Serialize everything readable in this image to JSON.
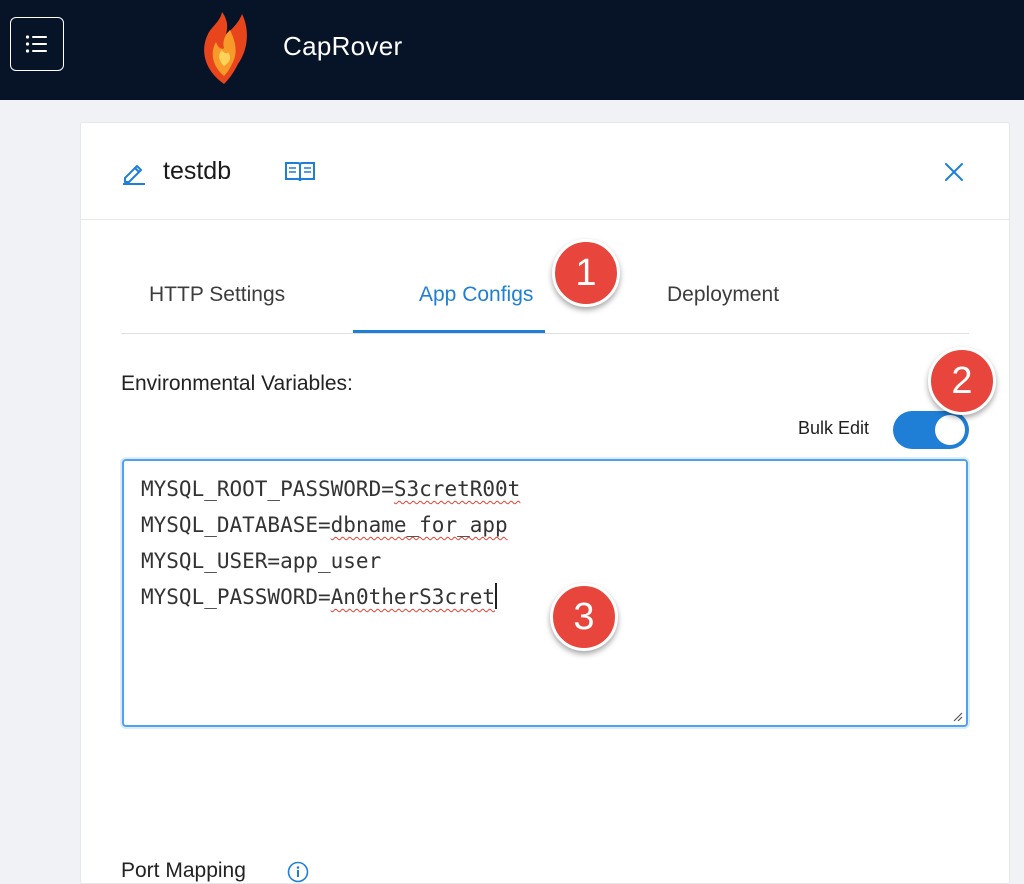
{
  "header": {
    "brand": "CapRover",
    "menu_icon": "list-icon",
    "logo_icon": "flame-logo-icon"
  },
  "app": {
    "name": "testdb",
    "edit_icon": "pencil-icon",
    "docs_icon": "book-icon",
    "close_icon": "close-icon"
  },
  "tabs": [
    {
      "label": "HTTP Settings",
      "active": false
    },
    {
      "label": "App Configs",
      "active": true
    },
    {
      "label": "Deployment",
      "active": false
    }
  ],
  "env": {
    "label": "Environmental Variables:",
    "bulk_edit_label": "Bulk Edit",
    "bulk_edit_on": true,
    "lines": [
      {
        "key": "MYSQL_ROOT_PASSWORD=",
        "value": "S3cretR00t"
      },
      {
        "key": "MYSQL_DATABASE=",
        "value": "dbname_for_app"
      },
      {
        "key": "MYSQL_USER=",
        "value": "app_user"
      },
      {
        "key": "MYSQL_PASSWORD=",
        "value": "An0therS3cret"
      }
    ]
  },
  "port_mapping": {
    "label": "Port Mapping",
    "info_icon": "info-icon"
  },
  "annotations": [
    "1",
    "2",
    "3"
  ],
  "colors": {
    "accent": "#1f7fd6",
    "header_bg": "#071427",
    "badge": "#e8453c"
  }
}
